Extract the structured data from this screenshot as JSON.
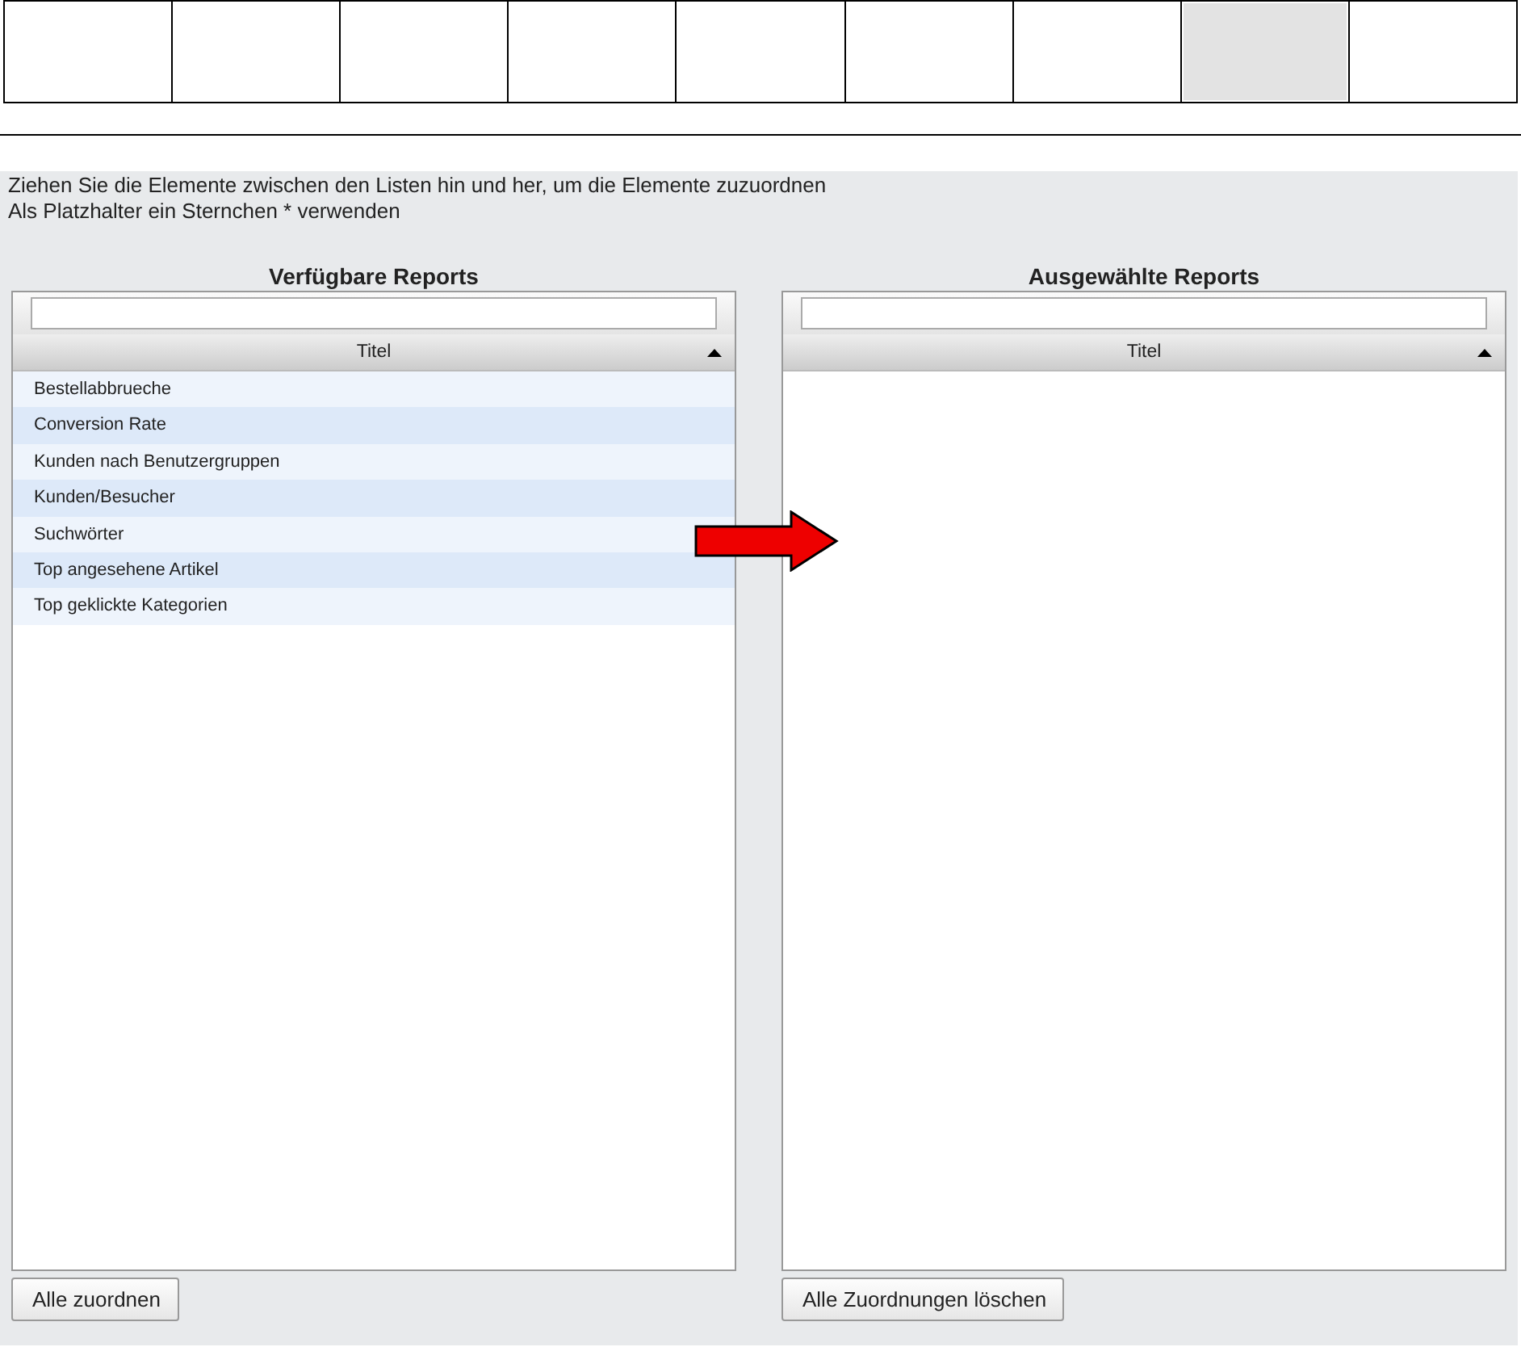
{
  "top_boxes": [
    {
      "selected": false
    },
    {
      "selected": false
    },
    {
      "selected": false
    },
    {
      "selected": false
    },
    {
      "selected": false
    },
    {
      "selected": false
    },
    {
      "selected": false
    },
    {
      "selected": true
    },
    {
      "selected": false
    }
  ],
  "instructions": [
    "Ziehen Sie die Elemente zwischen den Listen hin und her, um die Elemente zuzuordnen",
    "Als Platzhalter ein Sternchen * verwenden"
  ],
  "lists": [
    {
      "title": "Verfügbare Reports",
      "column": "Titel",
      "rows": [
        "Bestellabbrueche",
        "Conversion Rate",
        "Kunden nach Benutzergruppen",
        "Kunden/Besucher",
        "Suchwörter",
        "Top angesehene Artikel",
        "Top geklickte Kategorien"
      ],
      "button": "Alle zuordnen"
    },
    {
      "title": "Ausgewählte Reports",
      "column": "Titel",
      "button": "Alle Zuordnungen löschen"
    }
  ]
}
